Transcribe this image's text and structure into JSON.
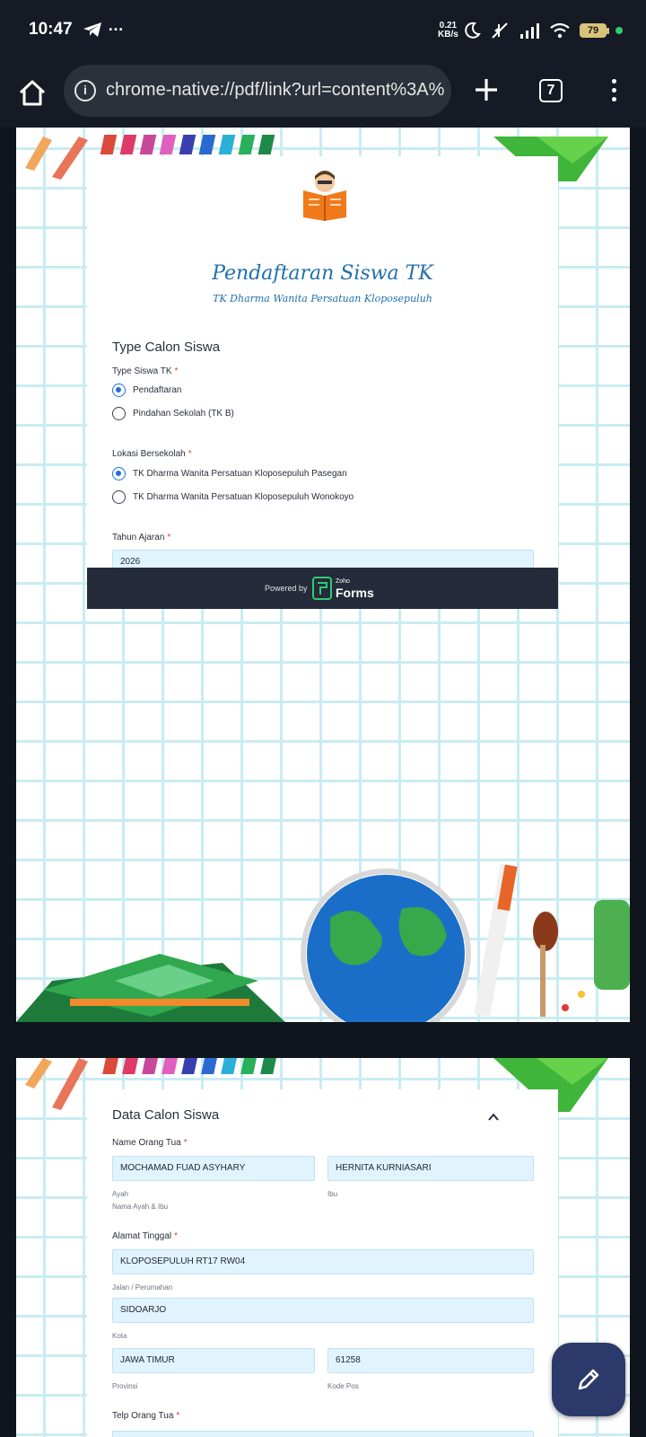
{
  "status_bar": {
    "time": "10:47",
    "overflow": "…",
    "net_speed_value": "0.21",
    "net_speed_unit": "KB/s",
    "battery": "79",
    "icons": [
      "telegram-icon",
      "moon-icon",
      "mute-icon",
      "signal-icon",
      "wifi-icon",
      "battery-icon"
    ]
  },
  "browser": {
    "url": "chrome-native://pdf/link?url=content%3A%",
    "tab_count": "7",
    "icons": [
      "home-icon",
      "info-icon",
      "plus-icon",
      "tabs-icon",
      "kebab-menu-icon"
    ]
  },
  "form": {
    "title": "Pendaftaran Siswa TK",
    "subtitle": "TK Dharma Wanita Persatuan Kloposepuluh",
    "section1_title": "Type Calon Siswa",
    "type_label": "Type Siswa TK",
    "type_options": [
      {
        "label": "Pendaftaran",
        "selected": true
      },
      {
        "label": "Pindahan Sekolah (TK B)",
        "selected": false
      }
    ],
    "lokasi_label": "Lokasi Bersekolah",
    "lokasi_options": [
      {
        "label": "TK Dharma Wanita Persatuan Kloposepuluh Pasegan",
        "selected": true
      },
      {
        "label": "TK Dharma Wanita Persatuan Kloposepuluh Wonokoyo",
        "selected": false
      }
    ],
    "tahun_label": "Tahun Ajaran",
    "tahun_value": "2026",
    "required_mark": "*"
  },
  "powered": {
    "text": "Powered by",
    "brand_small": "Zoho",
    "brand": "Forms"
  },
  "page2": {
    "section_title": "Data Calon Siswa",
    "parent_name_label": "Name Orang Tua",
    "father_value": "MOCHAMAD FUAD ASYHARY",
    "mother_value": "HERNITA KURNIASARI",
    "father_helper": "Ayah",
    "mother_helper": "Ibu",
    "parent_helper": "Nama Ayah & Ibu",
    "address_label": "Alamat Tinggal",
    "street_value": "KLOPOSEPULUH RT17 RW04",
    "street_helper": "Jalan / Perumahan",
    "city_value": "SIDOARJO",
    "city_helper": "Kota",
    "province_value": "JAWA TIMUR",
    "province_helper": "Provinsi",
    "postal_value": "61258",
    "postal_helper": "Kode Pos",
    "phone_label": "Telp Orang Tua"
  },
  "fab": {
    "icon": "pencil-icon"
  },
  "colors": {
    "title_blue": "#1f6fb0",
    "radio_blue": "#1e6fd9",
    "input_bg": "#e1f4fd",
    "required_red": "#e53935",
    "footer_dark": "#252b3a",
    "fab_navy": "#2b3a6b"
  }
}
